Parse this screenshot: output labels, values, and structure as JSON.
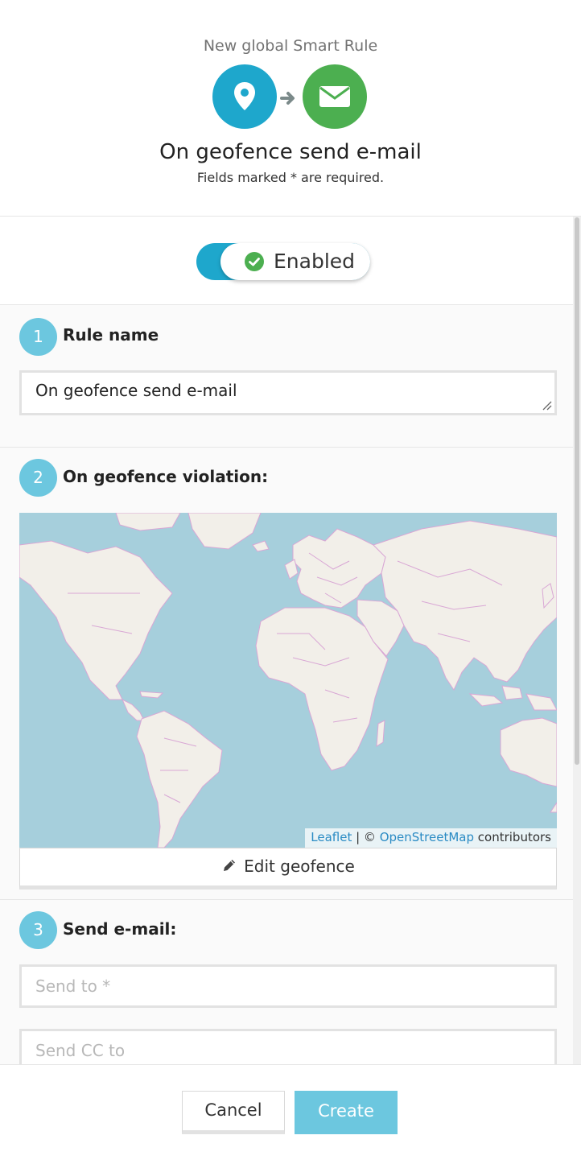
{
  "header": {
    "subtitle": "New global Smart Rule",
    "title": "On geofence send e-mail",
    "required_note": "Fields marked * are required.",
    "icons": [
      "location-pin-icon",
      "arrow-right-icon",
      "envelope-icon"
    ]
  },
  "toggle": {
    "label": "Enabled",
    "state": "on"
  },
  "sections": {
    "rule_name": {
      "number": "1",
      "label": "Rule name",
      "value": "On geofence send e-mail"
    },
    "geofence": {
      "number": "2",
      "label": "On geofence violation:",
      "attribution_leaflet": "Leaflet",
      "attribution_sep": " | © ",
      "attribution_osm": "OpenStreetMap",
      "attribution_rest": " contributors",
      "edit_button": "Edit geofence"
    },
    "email": {
      "number": "3",
      "label": "Send e-mail:",
      "send_to_placeholder": "Send to *",
      "send_cc_placeholder": "Send CC to"
    }
  },
  "footer": {
    "cancel_label": "Cancel",
    "create_label": "Create"
  },
  "colors": {
    "accent": "#1ea7cc",
    "success": "#4caf50",
    "step": "#6cc7df",
    "map_water": "#a6cfdc",
    "map_land": "#f2efe9",
    "map_borders": "#d9a7d5"
  }
}
